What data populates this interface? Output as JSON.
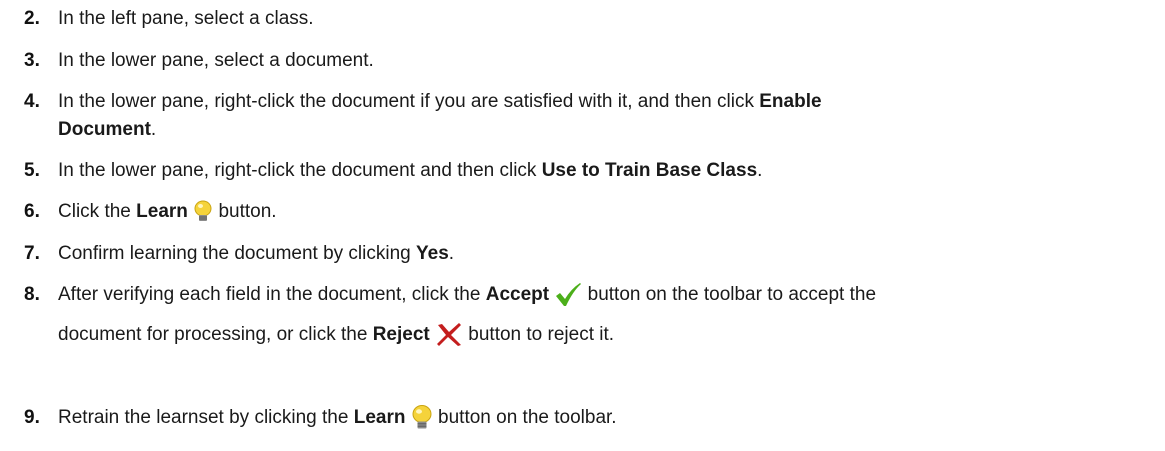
{
  "steps": [
    {
      "num": "2.",
      "a": "In the left pane, select a class."
    },
    {
      "num": "3.",
      "a": "In the lower pane, select a document."
    },
    {
      "num": "4.",
      "a": "In the lower pane, right-click the document if you are satisfied with it, and then click ",
      "b1": "Enable",
      "b2": "Document",
      "c": "."
    },
    {
      "num": "5.",
      "a": "In the lower pane, right-click the document and then click ",
      "b": "Use to Train Base Class",
      "c": "."
    },
    {
      "num": "6.",
      "a": "Click the ",
      "b": "Learn",
      "c": " button.",
      "icon": "lightbulb-icon"
    },
    {
      "num": "7.",
      "a": "Confirm learning the document by clicking ",
      "b": "Yes",
      "c": "."
    },
    {
      "num": "8.",
      "a": "After verifying each field in the document, click the ",
      "b": "Accept",
      "c": " button on the toolbar to accept the",
      "d": "document for processing, or click the ",
      "e": "Reject",
      "f": " button to reject it.",
      "icon1": "checkmark-icon",
      "icon2": "x-mark-icon"
    },
    {
      "num": "9.",
      "a": "Retrain the learnset by clicking the ",
      "b": "Learn",
      "c": " button on the toolbar.",
      "icon": "lightbulb-icon"
    }
  ],
  "colors": {
    "checkmark": "#4caf1a",
    "xmark": "#c41e1e",
    "bulb": "#f5d33b",
    "bulb_base": "#8c8c8c"
  }
}
